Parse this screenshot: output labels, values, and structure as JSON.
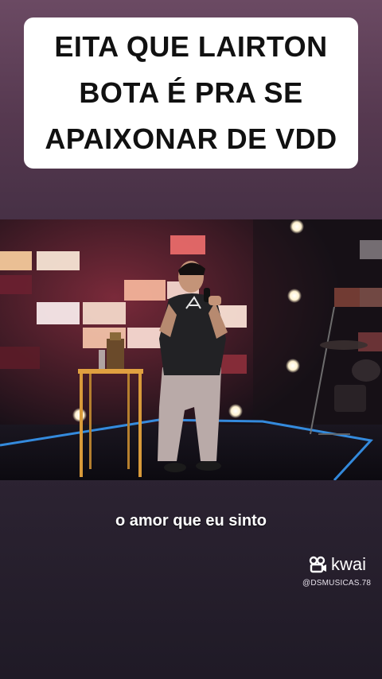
{
  "caption": {
    "lines": [
      "EITA QUE LAIRTON",
      "BOTA É PRA SE",
      "APAIXONAR DE VDD"
    ]
  },
  "video": {
    "subtitle": "o amor que eu sinto"
  },
  "watermark": {
    "brand": "kwai",
    "handle": "@DSMUSICAS.78",
    "icon": "kwai-logo-icon"
  },
  "colors": {
    "stage_lights": "#f06060",
    "stage_floor_glow": "#3aa0ff",
    "background_top": "#6b4a63",
    "background_bottom": "#1f1a26"
  }
}
